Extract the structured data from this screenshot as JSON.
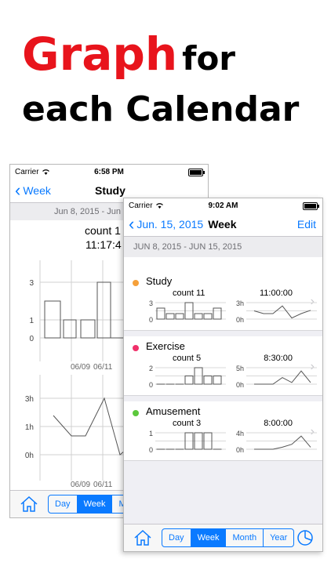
{
  "headline": {
    "word1": "Graph",
    "word2": "for",
    "line2": "each Calendar"
  },
  "back_phone": {
    "carrier": "Carrier",
    "time": "6:58 PM",
    "back_label": "Week",
    "title": "Study",
    "range": "Jun 8, 2015 - Jun",
    "count_label": "count 1",
    "duration_label": "11:17:4",
    "count_axis": [
      "3",
      "1",
      "0"
    ],
    "count_dates": [
      "06/09",
      "06/11"
    ],
    "hours_axis": [
      "3h",
      "1h",
      "0h"
    ],
    "hours_dates": [
      "06/09",
      "06/11"
    ],
    "tabs": [
      "Day",
      "Week",
      "Mo"
    ],
    "selected_tab": "Week"
  },
  "front_phone": {
    "carrier": "Carrier",
    "time": "9:02 AM",
    "back_label": "Jun. 15, 2015",
    "title": "Week",
    "edit_label": "Edit",
    "range": "JUN 8, 2015 - JUN 15, 2015",
    "tabs": [
      "Day",
      "Week",
      "Month",
      "Year"
    ],
    "selected_tab": "Week",
    "calendars": [
      {
        "name": "Study",
        "color": "#f5a03a",
        "count": "count 11",
        "duration": "11:00:00",
        "count_axis": [
          "3",
          "0"
        ],
        "hours_axis": [
          "3h",
          "0h"
        ],
        "counts": [
          2,
          1,
          1,
          3,
          1,
          1,
          2
        ],
        "count_max": 3,
        "hours": [
          1.5,
          1.0,
          1.0,
          2.4,
          0.2,
          1.0,
          1.6
        ],
        "hours_max": 3
      },
      {
        "name": "Exercise",
        "color": "#f0306a",
        "count": "count 5",
        "duration": "8:30:00",
        "count_axis": [
          "2",
          "0"
        ],
        "hours_axis": [
          "5h",
          "0h"
        ],
        "counts": [
          0,
          0,
          0,
          1,
          2,
          1,
          1
        ],
        "count_max": 2,
        "hours": [
          0,
          0,
          0,
          2,
          0.5,
          4,
          0.5
        ],
        "hours_max": 5
      },
      {
        "name": "Amusement",
        "color": "#5cc83c",
        "count": "count 3",
        "duration": "8:00:00",
        "count_axis": [
          "1",
          "0"
        ],
        "hours_axis": [
          "4h",
          "0h"
        ],
        "counts": [
          0,
          0,
          0,
          1,
          1,
          1,
          0
        ],
        "count_max": 1,
        "hours": [
          0,
          0,
          0,
          0.5,
          1.2,
          3.2,
          0.5
        ],
        "hours_max": 4
      }
    ]
  }
}
